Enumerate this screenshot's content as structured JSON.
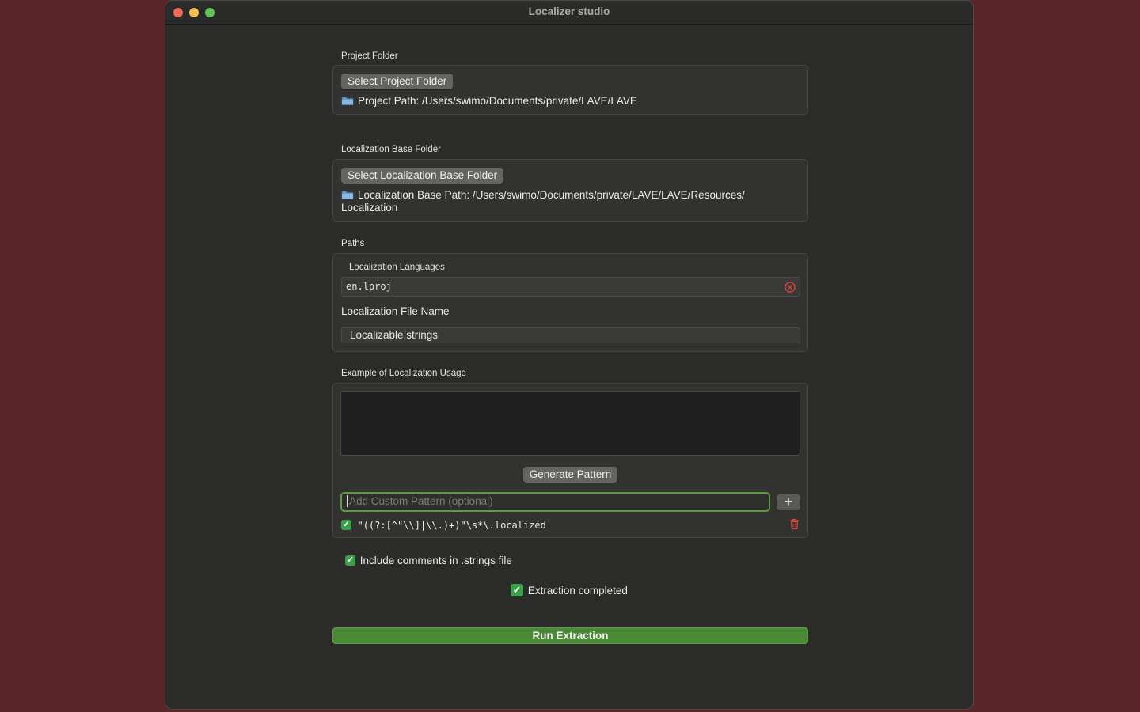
{
  "window": {
    "title": "Localizer studio"
  },
  "project": {
    "section_label": "Project Folder",
    "button_label": "Select Project Folder",
    "path_text": "Project Path: /Users/swimo/Documents/private/LAVE/LAVE"
  },
  "localization_base": {
    "section_label": "Localization Base Folder",
    "button_label": "Select Localization Base Folder",
    "path_line1": "Localization Base Path: /Users/swimo/Documents/private/LAVE/LAVE/Resources/",
    "path_line2": "Localization"
  },
  "paths": {
    "section_label": "Paths",
    "languages_label": "Localization Languages",
    "languages_value": "en.lproj",
    "file_name_label": "Localization File Name",
    "file_name_value": "Localizable.strings"
  },
  "example": {
    "section_label": "Example of Localization Usage",
    "textarea_value": "",
    "generate_button_label": "Generate Pattern",
    "custom_pattern_placeholder": "Add Custom Pattern (optional)",
    "add_button_label": "+",
    "patterns": [
      {
        "checked": true,
        "text": "\"((?:[^\"\\\\]|\\\\.)+)\"\\s*\\.localized"
      }
    ]
  },
  "options": {
    "include_comments_label": "Include comments in .strings file",
    "include_comments_checked": true
  },
  "status": {
    "text": "Extraction completed",
    "checked": true
  },
  "run_button_label": "Run Extraction",
  "colors": {
    "background": "#5b2529",
    "window": "#2b2b2a",
    "accent_green": "#4a8a36",
    "focus_ring": "#5f9a3e",
    "delete_red": "#d9453b"
  }
}
